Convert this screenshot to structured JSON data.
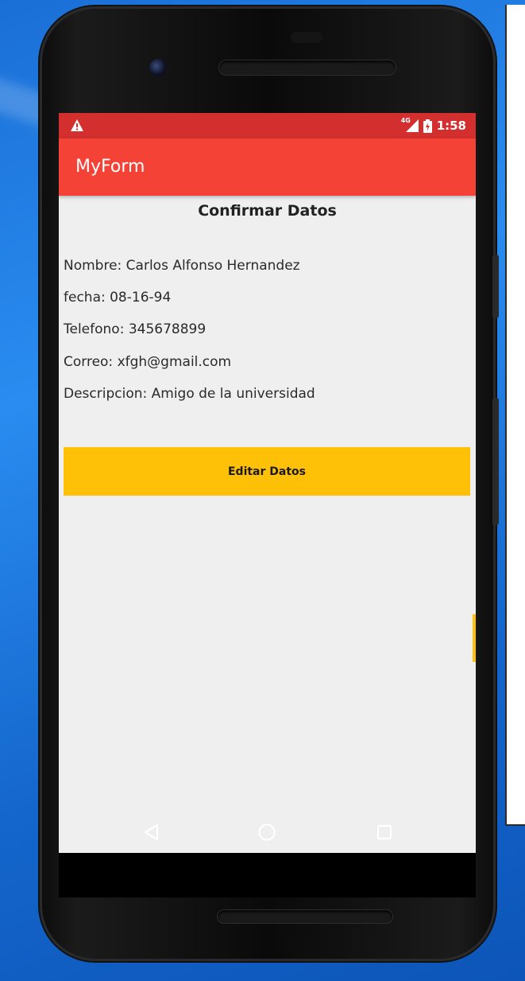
{
  "status_bar": {
    "network": "4G",
    "time": "1:58"
  },
  "app_bar": {
    "title": "MyForm"
  },
  "content": {
    "title": "Confirmar Datos",
    "fields": [
      "Nombre: Carlos Alfonso Hernandez",
      "fecha: 08-16-94",
      "Telefono: 345678899",
      "Correo: xfgh@gmail.com",
      "Descripcion: Amigo de la universidad"
    ],
    "edit_button": "Editar Datos"
  },
  "colors": {
    "status_bar": "#d32f2f",
    "app_bar": "#f44336",
    "button": "#ffc107",
    "background": "#efefef"
  },
  "icons": {
    "status": [
      "warning-icon",
      "signal-icon",
      "battery-icon"
    ],
    "navigation": [
      "back-icon",
      "home-icon",
      "recents-icon"
    ]
  }
}
